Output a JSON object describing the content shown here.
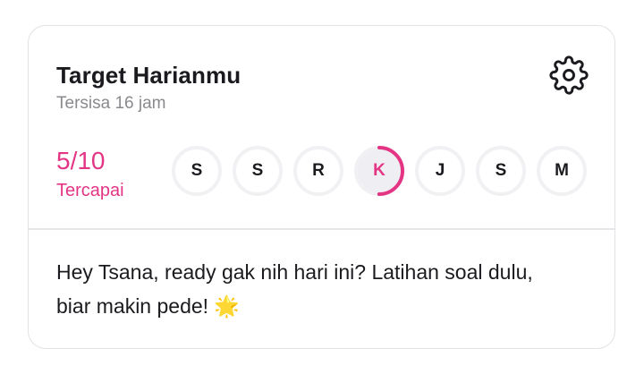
{
  "header": {
    "title": "Target Harianmu",
    "subtitle": "Tersisa 16 jam",
    "settings_icon": "gear-icon"
  },
  "progress": {
    "value_text": "5/10",
    "label": "Tercapai",
    "current": 5,
    "target": 10,
    "fraction": 0.5,
    "accent_color": "#e43585"
  },
  "days": [
    {
      "label": "S",
      "active": false
    },
    {
      "label": "S",
      "active": false
    },
    {
      "label": "R",
      "active": false
    },
    {
      "label": "K",
      "active": true
    },
    {
      "label": "J",
      "active": false
    },
    {
      "label": "S",
      "active": false
    },
    {
      "label": "M",
      "active": false
    }
  ],
  "message": {
    "text": "Hey Tsana, ready gak nih hari ini? Latihan soal dulu, biar makin pede! 🌟"
  }
}
